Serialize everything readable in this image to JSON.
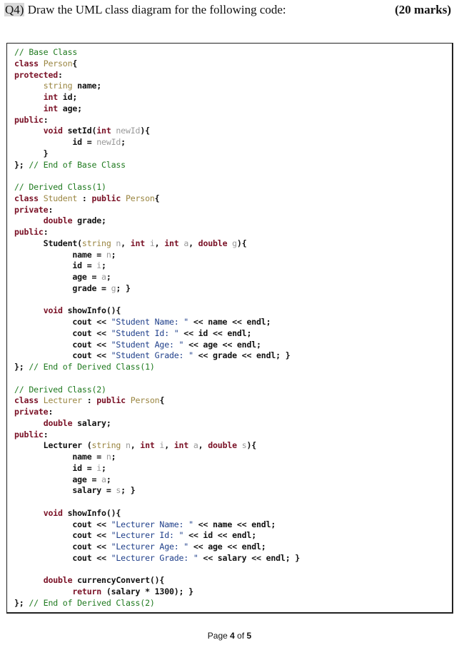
{
  "question": {
    "number": "Q4)",
    "text": " Draw the UML class diagram for the following code:",
    "marks": "(20 marks)"
  },
  "code_lines": [
    [
      [
        "cmt",
        "// Base Class"
      ]
    ],
    [
      [
        "kw",
        "class "
      ],
      [
        "cls",
        "Person"
      ],
      [
        "plain",
        "{"
      ]
    ],
    [
      [
        "kw",
        "protected"
      ],
      [
        "plain",
        ":"
      ]
    ],
    [
      [
        "plain",
        "      "
      ],
      [
        "ty",
        "string"
      ],
      [
        "plain",
        " name;"
      ]
    ],
    [
      [
        "plain",
        "      "
      ],
      [
        "kw",
        "int"
      ],
      [
        "plain",
        " id;"
      ]
    ],
    [
      [
        "plain",
        "      "
      ],
      [
        "kw",
        "int"
      ],
      [
        "plain",
        " age;"
      ]
    ],
    [
      [
        "kw",
        "public"
      ],
      [
        "plain",
        ":"
      ]
    ],
    [
      [
        "plain",
        "      "
      ],
      [
        "kw",
        "void"
      ],
      [
        "plain",
        " setId("
      ],
      [
        "kw",
        "int"
      ],
      [
        "prm",
        " newId"
      ],
      [
        "plain",
        "){"
      ]
    ],
    [
      [
        "plain",
        "            id = "
      ],
      [
        "prm",
        "newId"
      ],
      [
        "plain",
        ";"
      ]
    ],
    [
      [
        "plain",
        "      }"
      ]
    ],
    [
      [
        "plain",
        "}; "
      ],
      [
        "cmt",
        "// End of Base Class"
      ]
    ],
    [
      [
        "plain",
        ""
      ]
    ],
    [
      [
        "cmt",
        "// Derived Class(1)"
      ]
    ],
    [
      [
        "kw",
        "class "
      ],
      [
        "cls",
        "Student"
      ],
      [
        "plain",
        " : "
      ],
      [
        "kw",
        "public "
      ],
      [
        "cls",
        "Person"
      ],
      [
        "plain",
        "{"
      ]
    ],
    [
      [
        "kw",
        "private"
      ],
      [
        "plain",
        ":"
      ]
    ],
    [
      [
        "plain",
        "      "
      ],
      [
        "kw",
        "double"
      ],
      [
        "plain",
        " grade;"
      ]
    ],
    [
      [
        "kw",
        "public"
      ],
      [
        "plain",
        ":"
      ]
    ],
    [
      [
        "plain",
        "      Student("
      ],
      [
        "ty",
        "string"
      ],
      [
        "prm",
        " n"
      ],
      [
        "plain",
        ", "
      ],
      [
        "kw",
        "int"
      ],
      [
        "prm",
        " i"
      ],
      [
        "plain",
        ", "
      ],
      [
        "kw",
        "int"
      ],
      [
        "prm",
        " a"
      ],
      [
        "plain",
        ", "
      ],
      [
        "kw",
        "double"
      ],
      [
        "prm",
        " g"
      ],
      [
        "plain",
        "){"
      ]
    ],
    [
      [
        "plain",
        "            name = "
      ],
      [
        "prm",
        "n"
      ],
      [
        "plain",
        ";"
      ]
    ],
    [
      [
        "plain",
        "            id = "
      ],
      [
        "prm",
        "i"
      ],
      [
        "plain",
        ";"
      ]
    ],
    [
      [
        "plain",
        "            age = "
      ],
      [
        "prm",
        "a"
      ],
      [
        "plain",
        ";"
      ]
    ],
    [
      [
        "plain",
        "            grade = "
      ],
      [
        "prm",
        "g"
      ],
      [
        "plain",
        "; }"
      ]
    ],
    [
      [
        "plain",
        ""
      ]
    ],
    [
      [
        "plain",
        "      "
      ],
      [
        "kw",
        "void"
      ],
      [
        "plain",
        " showInfo(){"
      ]
    ],
    [
      [
        "plain",
        "            cout << "
      ],
      [
        "str",
        "\"Student Name: \""
      ],
      [
        "plain",
        " << name << endl;"
      ]
    ],
    [
      [
        "plain",
        "            cout << "
      ],
      [
        "str",
        "\"Student Id: \""
      ],
      [
        "plain",
        " << id << endl;"
      ]
    ],
    [
      [
        "plain",
        "            cout << "
      ],
      [
        "str",
        "\"Student Age: \""
      ],
      [
        "plain",
        " << age << endl;"
      ]
    ],
    [
      [
        "plain",
        "            cout << "
      ],
      [
        "str",
        "\"Student Grade: \""
      ],
      [
        "plain",
        " << grade << endl; }"
      ]
    ],
    [
      [
        "plain",
        "}; "
      ],
      [
        "cmt",
        "// End of Derived Class(1)"
      ]
    ],
    [
      [
        "plain",
        ""
      ]
    ],
    [
      [
        "cmt",
        "// Derived Class(2)"
      ]
    ],
    [
      [
        "kw",
        "class "
      ],
      [
        "cls",
        "Lecturer"
      ],
      [
        "plain",
        " : "
      ],
      [
        "kw",
        "public "
      ],
      [
        "cls",
        "Person"
      ],
      [
        "plain",
        "{"
      ]
    ],
    [
      [
        "kw",
        "private"
      ],
      [
        "plain",
        ":"
      ]
    ],
    [
      [
        "plain",
        "      "
      ],
      [
        "kw",
        "double"
      ],
      [
        "plain",
        " salary;"
      ]
    ],
    [
      [
        "kw",
        "public"
      ],
      [
        "plain",
        ":"
      ]
    ],
    [
      [
        "plain",
        "      Lecturer ("
      ],
      [
        "ty",
        "string"
      ],
      [
        "prm",
        " n"
      ],
      [
        "plain",
        ", "
      ],
      [
        "kw",
        "int"
      ],
      [
        "prm",
        " i"
      ],
      [
        "plain",
        ", "
      ],
      [
        "kw",
        "int"
      ],
      [
        "prm",
        " a"
      ],
      [
        "plain",
        ", "
      ],
      [
        "kw",
        "double"
      ],
      [
        "prm",
        " s"
      ],
      [
        "plain",
        "){"
      ]
    ],
    [
      [
        "plain",
        "            name = "
      ],
      [
        "prm",
        "n"
      ],
      [
        "plain",
        ";"
      ]
    ],
    [
      [
        "plain",
        "            id = "
      ],
      [
        "prm",
        "i"
      ],
      [
        "plain",
        ";"
      ]
    ],
    [
      [
        "plain",
        "            age = "
      ],
      [
        "prm",
        "a"
      ],
      [
        "plain",
        ";"
      ]
    ],
    [
      [
        "plain",
        "            salary = "
      ],
      [
        "prm",
        "s"
      ],
      [
        "plain",
        "; }"
      ]
    ],
    [
      [
        "plain",
        ""
      ]
    ],
    [
      [
        "plain",
        "      "
      ],
      [
        "kw",
        "void"
      ],
      [
        "plain",
        " showInfo(){"
      ]
    ],
    [
      [
        "plain",
        "            cout << "
      ],
      [
        "str",
        "\"Lecturer Name: \""
      ],
      [
        "plain",
        " << name << endl;"
      ]
    ],
    [
      [
        "plain",
        "            cout << "
      ],
      [
        "str",
        "\"Lecturer Id: \""
      ],
      [
        "plain",
        " << id << endl;"
      ]
    ],
    [
      [
        "plain",
        "            cout << "
      ],
      [
        "str",
        "\"Lecturer Age: \""
      ],
      [
        "plain",
        " << age << endl;"
      ]
    ],
    [
      [
        "plain",
        "            cout << "
      ],
      [
        "str",
        "\"Lecturer Grade: \""
      ],
      [
        "plain",
        " << salary << endl; }"
      ]
    ],
    [
      [
        "plain",
        ""
      ]
    ],
    [
      [
        "plain",
        "      "
      ],
      [
        "kw",
        "double"
      ],
      [
        "plain",
        " currencyConvert(){"
      ]
    ],
    [
      [
        "plain",
        "            "
      ],
      [
        "kw",
        "return"
      ],
      [
        "plain",
        " (salary * 1300); }"
      ]
    ],
    [
      [
        "plain",
        "}; "
      ],
      [
        "cmt",
        "// End of Derived Class(2)"
      ]
    ]
  ],
  "footer": {
    "prefix": "Page ",
    "current": "4",
    "middle": " of ",
    "total": "5"
  },
  "colors": {
    "comment": "#1f7a1f",
    "keyword": "#7a1126",
    "type": "#9a8540",
    "param": "#9a9a9a",
    "string": "#1f3f8a"
  }
}
